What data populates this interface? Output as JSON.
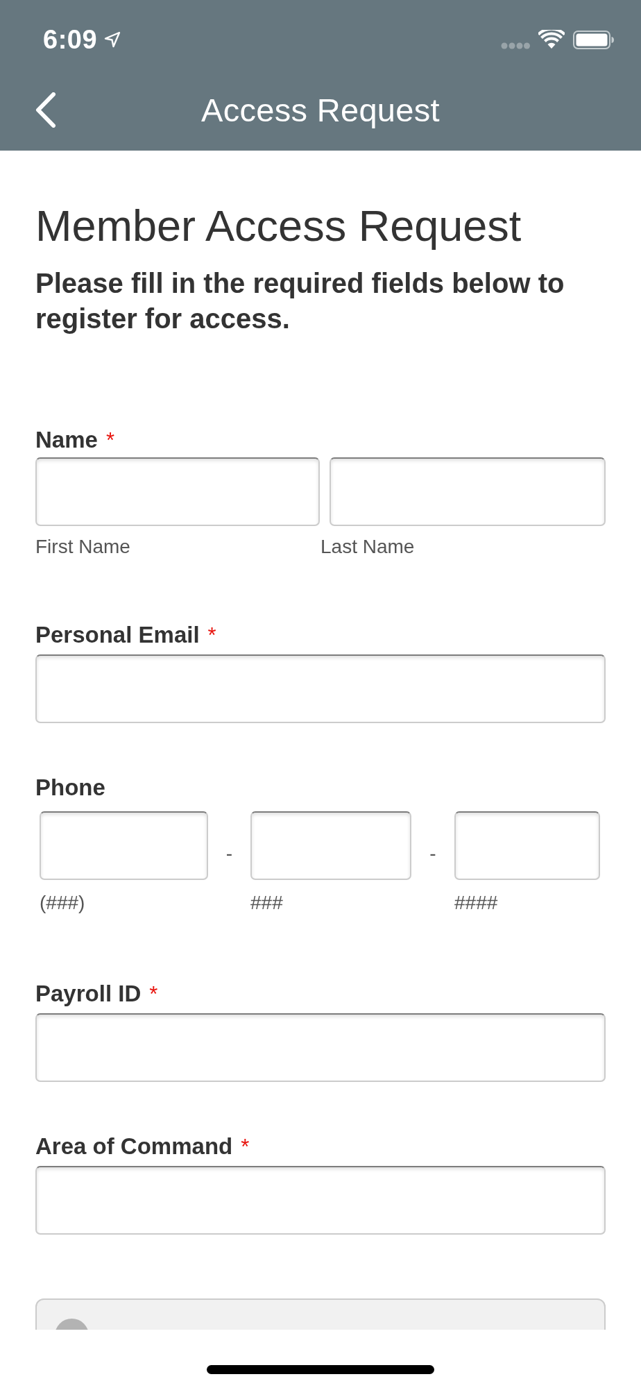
{
  "status_bar": {
    "time": "6:09"
  },
  "nav_bar": {
    "title": "Access Request"
  },
  "form": {
    "title": "Member Access Request",
    "subtitle": "Please fill in the required fields below to register for access.",
    "fields": [
      {
        "kind": "name",
        "label": "Name",
        "required_mark": "*",
        "parts": [
          {
            "sublabel": "First Name"
          },
          {
            "sublabel": "Last Name"
          }
        ]
      },
      {
        "kind": "text",
        "label": "Personal Email",
        "required_mark": "*"
      },
      {
        "kind": "phone",
        "label": "Phone",
        "parts": [
          {
            "sublabel": "(###)"
          },
          {
            "separator": "-",
            "sublabel": "###"
          },
          {
            "separator": "-",
            "sublabel": "####"
          }
        ]
      },
      {
        "kind": "text",
        "label": "Payroll ID",
        "required_mark": "*"
      },
      {
        "kind": "text",
        "label": "Area of Command",
        "required_mark": "*"
      }
    ]
  }
}
